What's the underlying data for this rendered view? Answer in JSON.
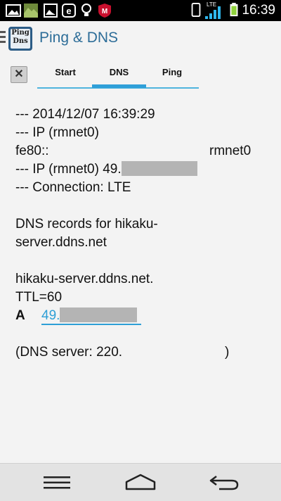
{
  "status_bar": {
    "icons": [
      "image-icon",
      "photo-icon",
      "gallery-icon",
      "e-icon",
      "bulb-icon",
      "mcafee-icon"
    ],
    "right_icons": [
      "phone-icon",
      "lte-icon",
      "signal-icon",
      "battery-icon"
    ],
    "lte_label": "LTE",
    "time": "16:39"
  },
  "app": {
    "title": "Ping & DNS",
    "logo_text_top": "Ping",
    "logo_text_bottom": "Dns"
  },
  "tabs": {
    "close_label": "✕",
    "items": [
      "Start",
      "DNS",
      "Ping"
    ],
    "active": "DNS"
  },
  "output": {
    "timestamp_line": "--- 2014/12/07 16:39:29",
    "ip_header": "--- IP (rmnet0)",
    "ipv6_prefix": "fe80::",
    "ipv6_iface": "rmnet0",
    "ipv4_line": "--- IP (rmnet0) 49.",
    "connection_line": "--- Connection: LTE",
    "dns_records_line1": "DNS records for hikaku-",
    "dns_records_line2": "server.ddns.net",
    "host_line": "hikaku-server.ddns.net.",
    "ttl_line": "TTL=60",
    "record_type": "A",
    "record_value": "49.",
    "dns_server_label": "(DNS server: 220.",
    "dns_server_close": ")"
  },
  "navbar": {
    "menu_icon": "menu-icon",
    "home_icon": "home-icon",
    "back_icon": "back-icon"
  }
}
